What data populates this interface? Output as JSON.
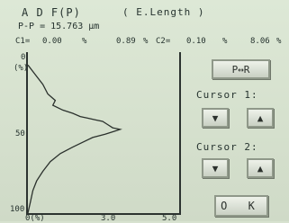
{
  "header": {
    "title": "A D F(P)",
    "mode": "( E.Length   )"
  },
  "readout": {
    "pp": "P-P = 15.763 µm"
  },
  "cursors": {
    "c1_label": "C1=",
    "c1_val1": "0.00",
    "c1_unit1": "%",
    "c1_val2": "0.89",
    "c1_unit2": "%",
    "c2_label": "C2=",
    "c2_val1": "0.10",
    "c2_unit1": "%",
    "c2_val2": "8.06",
    "c2_unit2": "%"
  },
  "plot": {
    "y_top": "0",
    "y_unit": "(%)",
    "y_mid": "50",
    "y_bottom": "100",
    "x_left": "0(%)",
    "x_mid": "3.0",
    "x_right": "5.0"
  },
  "chart_data": {
    "type": "line",
    "title": "",
    "xlabel": "",
    "ylabel": "",
    "xlim": [
      0,
      6
    ],
    "ylim": [
      0,
      100
    ],
    "series": [
      {
        "x": [
          0.0,
          0.3,
          0.6,
          0.8,
          1.1,
          1.0,
          1.4,
          1.8,
          2.1,
          2.4,
          2.7,
          3.0,
          3.2,
          3.4,
          3.7,
          3.5,
          3.1,
          2.6,
          2.2,
          1.8,
          1.3,
          0.9,
          0.6,
          0.35,
          0.2,
          0.1,
          0.0
        ],
        "y": [
          8,
          14,
          20,
          26,
          30,
          33,
          36,
          38,
          40,
          41,
          42,
          43,
          45,
          47,
          48,
          49,
          51,
          53,
          56,
          59,
          63,
          68,
          74,
          80,
          86,
          93,
          100
        ]
      }
    ]
  },
  "controls": {
    "pr_button": "P↔R",
    "cursor1_label": "Cursor 1:",
    "cursor2_label": "Cursor 2:",
    "down_arrow": "▼",
    "up_arrow": "▲",
    "ok_button": "O K"
  }
}
